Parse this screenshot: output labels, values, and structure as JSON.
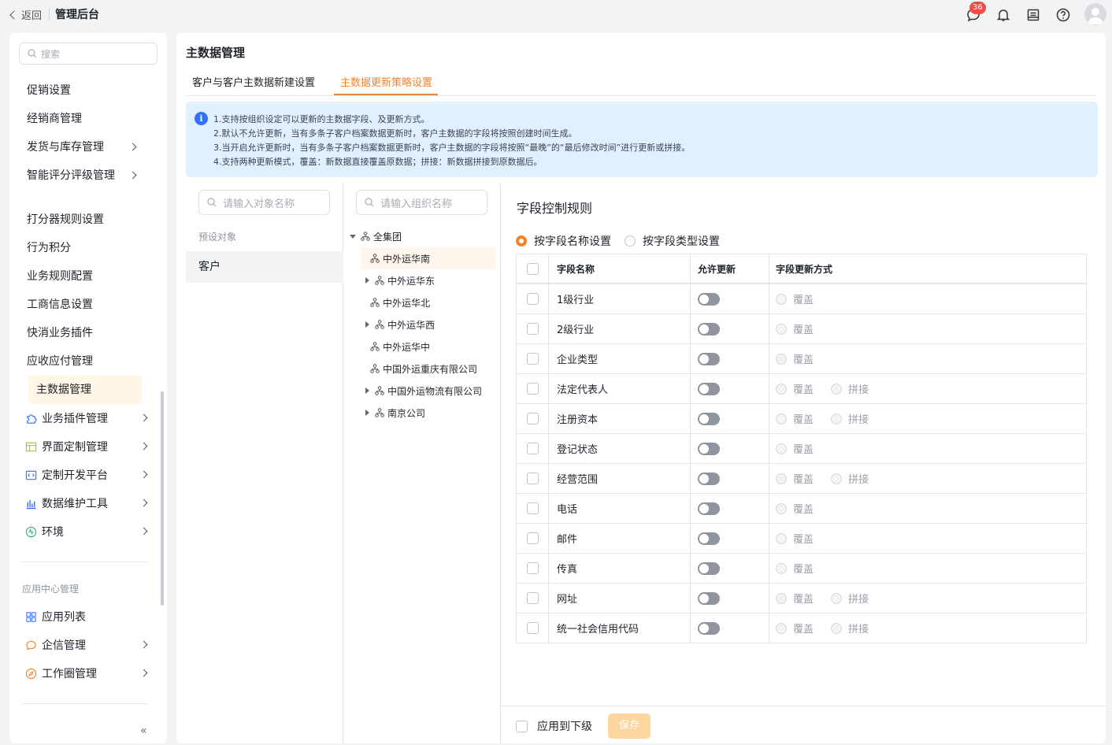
{
  "topbar": {
    "back_label": "返回",
    "app_title": "管理后台",
    "msg_count": "36"
  },
  "sidebar": {
    "search_placeholder": "搜索",
    "items": [
      "促销设置",
      "经销商管理",
      "发货与库存管理",
      "智能评分评级管理",
      "打分器规则设置",
      "行为积分",
      "业务规则配置",
      "工商信息设置",
      "快消业务插件",
      "应收应付管理",
      "主数据管理"
    ],
    "groups": [
      "业务插件管理",
      "界面定制管理",
      "定制开发平台",
      "数据维护工具",
      "环境"
    ],
    "section_title": "应用中心管理",
    "apps": [
      "应用列表",
      "企信管理",
      "工作圈管理"
    ]
  },
  "main": {
    "title": "主数据管理",
    "tabs": [
      "客户与客户主数据新建设置",
      "主数据更新策略设置"
    ],
    "notice": [
      "1.支持按组织设定可以更新的主数据字段、及更新方式。",
      "2.默认不允许更新，当有多条子客户档案数据更新时，客户主数据的字段将按照创建时间生成。",
      "3.当开启允许更新时，当有多条子客户档案数据更新时，客户主数据的字段将按照“最晚”的“最后修改时间”进行更新或拼接。",
      "4.支持两种更新模式，覆盖：新数据直接覆盖原数据；拼接：新数据拼接到原数据后。"
    ],
    "objects": {
      "search_placeholder": "请输入对象名称",
      "preset_label": "预设对象",
      "selected": "客户"
    },
    "orgs": {
      "search_placeholder": "请输入组织名称",
      "root": "全集团",
      "children": [
        "中外运华南",
        "中外运华东",
        "中外运华北",
        "中外运华西",
        "中外运华中",
        "中国外运重庆有限公司",
        "中国外运物流有限公司",
        "南京公司"
      ]
    },
    "rules": {
      "title": "字段控制规则",
      "mode_options": [
        "按字段名称设置",
        "按字段类型设置"
      ],
      "headers": [
        "字段名称",
        "允许更新",
        "字段更新方式"
      ],
      "rows": [
        {
          "name": "1级行业",
          "opts": [
            "覆盖"
          ]
        },
        {
          "name": "2级行业",
          "opts": [
            "覆盖"
          ]
        },
        {
          "name": "企业类型",
          "opts": [
            "覆盖"
          ]
        },
        {
          "name": "法定代表人",
          "opts": [
            "覆盖",
            "拼接"
          ]
        },
        {
          "name": "注册资本",
          "opts": [
            "覆盖",
            "拼接"
          ]
        },
        {
          "name": "登记状态",
          "opts": [
            "覆盖"
          ]
        },
        {
          "name": "经营范围",
          "opts": [
            "覆盖",
            "拼接"
          ]
        },
        {
          "name": "电话",
          "opts": [
            "覆盖"
          ]
        },
        {
          "name": "邮件",
          "opts": [
            "覆盖"
          ]
        },
        {
          "name": "传真",
          "opts": [
            "覆盖"
          ]
        },
        {
          "name": "网址",
          "opts": [
            "覆盖",
            "拼接"
          ]
        },
        {
          "name": "统一社会信用代码",
          "opts": [
            "覆盖",
            "拼接"
          ]
        }
      ],
      "apply_label": "应用到下级",
      "save_label": "保存"
    }
  },
  "colors": {
    "accent": "#f5832a",
    "notice_bg": "#e1f0fd",
    "info_icon": "#3370ff"
  }
}
